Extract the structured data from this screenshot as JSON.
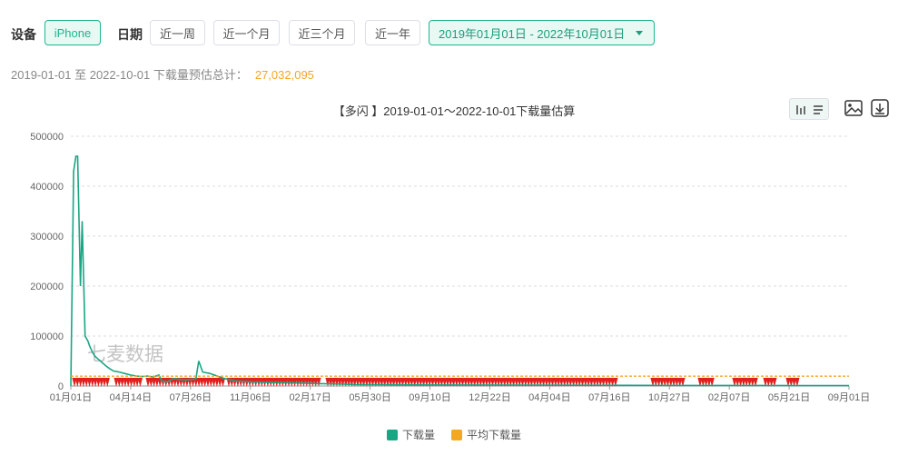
{
  "filters": {
    "device_label": "设备",
    "device_option": "iPhone",
    "date_label": "日期",
    "quick_ranges": [
      "近一周",
      "近一个月",
      "近三个月",
      "近一年"
    ],
    "date_range": "2019年01月01日 - 2022年10月01日"
  },
  "summary": {
    "text": "2019-01-01 至 2022-10-01 下载量预估总计：",
    "total": "27,032,095"
  },
  "watermark": "七麦数据",
  "colors": {
    "accent": "#1fb58f",
    "download_line": "#1aa583",
    "average_line": "#f5a623",
    "marker": "#e02020"
  },
  "icons": [
    "bar-chart-icon",
    "list-icon",
    "image-icon",
    "download-icon"
  ],
  "chart_data": {
    "type": "line",
    "title": "【多闪 】2019-01-01～2022-10-01下载量估算",
    "xlabel": "",
    "ylabel": "",
    "ylim": [
      0,
      500000
    ],
    "yticks": [
      "0",
      "100000",
      "200000",
      "300000",
      "400000",
      "500000"
    ],
    "xticks": [
      "01月01日",
      "04月14日",
      "07月26日",
      "11月06日",
      "02月17日",
      "05月30日",
      "09月10日",
      "12月22日",
      "04月04日",
      "07月16日",
      "10月27日",
      "02月07日",
      "05月21日",
      "09月01日"
    ],
    "grid": true,
    "legend": "bottom-center",
    "series": [
      {
        "name": "下载量",
        "x": [
          0,
          5,
          9,
          12,
          17,
          20,
          25,
          30,
          33,
          37,
          42,
          47,
          52,
          57,
          62,
          68,
          75,
          85,
          95,
          105,
          115,
          125,
          135,
          145,
          155,
          160,
          170,
          180,
          200,
          220,
          225,
          232,
          245,
          270,
          290,
          320,
          350,
          400,
          430,
          470,
          500,
          550,
          600,
          700,
          800,
          900,
          1000,
          1100,
          1200,
          1300,
          1369
        ],
        "y": [
          0,
          430000,
          460000,
          460000,
          200000,
          330000,
          100000,
          90000,
          80000,
          70000,
          60000,
          55000,
          50000,
          45000,
          40000,
          35000,
          30000,
          28000,
          25000,
          22000,
          20000,
          19000,
          20000,
          18000,
          22000,
          10000,
          8000,
          15000,
          12000,
          14000,
          50000,
          28000,
          25000,
          15000,
          10000,
          8000,
          7000,
          6000,
          5000,
          4000,
          3000,
          2500,
          2200,
          2000,
          1800,
          1500,
          1200,
          1000,
          1000,
          800,
          800
        ]
      },
      {
        "name": "平均下载量",
        "x": [
          0,
          1369
        ],
        "y": [
          19700,
          19700
        ]
      }
    ]
  }
}
